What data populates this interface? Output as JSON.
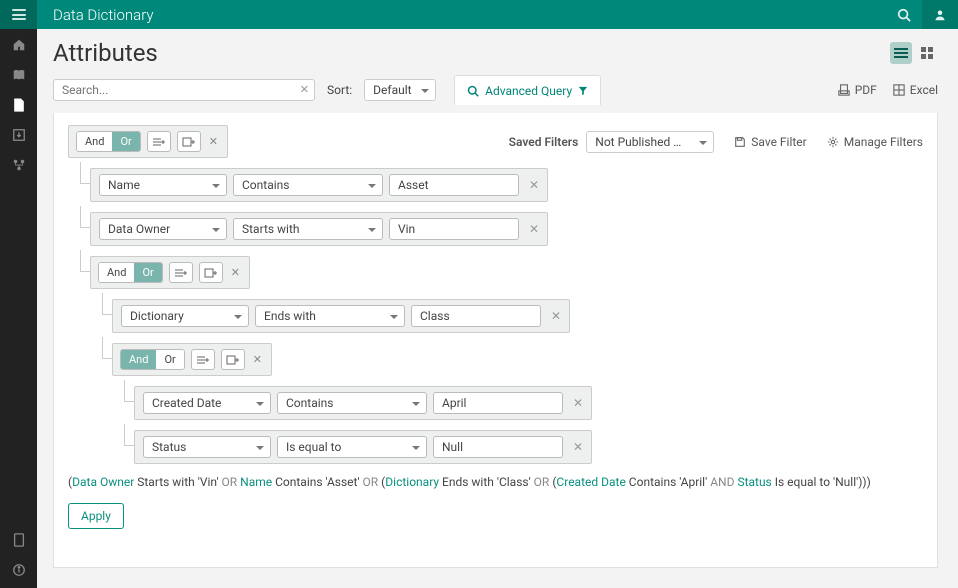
{
  "topbar": {
    "title": "Data Dictionary"
  },
  "page": {
    "title": "Attributes"
  },
  "search": {
    "placeholder": "Search..."
  },
  "sort": {
    "label": "Sort:",
    "value": "Default"
  },
  "advanced_query_label": "Advanced Query",
  "export": {
    "pdf": "PDF",
    "excel": "Excel"
  },
  "saved_filters": {
    "label": "Saved Filters",
    "selected": "Not Published …",
    "save_filter": "Save Filter",
    "manage_filters": "Manage Filters"
  },
  "logic": {
    "and": "And",
    "or": "Or"
  },
  "rows": [
    {
      "field": "Name",
      "op": "Contains",
      "val": "Asset"
    },
    {
      "field": "Data Owner",
      "op": "Starts with",
      "val": "Vin"
    },
    {
      "field": "Dictionary",
      "op": "Ends with",
      "val": "Class"
    },
    {
      "field": "Created Date",
      "op": "Contains",
      "val": "April"
    },
    {
      "field": "Status",
      "op": "Is equal to",
      "val": "Null"
    }
  ],
  "summary": {
    "p1": "(",
    "f1": "Data Owner",
    "t1": " Starts with 'Vin' ",
    "or1": "OR ",
    "f2": "Name",
    "t2": " Contains 'Asset' ",
    "or2": "OR ",
    "p2": "(",
    "f3": "Dictionary",
    "t3": " Ends with 'Class' ",
    "or3": "OR ",
    "p3": "(",
    "f4": "Created Date",
    "t4": " Contains 'April' ",
    "and1": "AND ",
    "f5": "Status",
    "t5": " Is equal to 'Null')))"
  },
  "apply": "Apply"
}
